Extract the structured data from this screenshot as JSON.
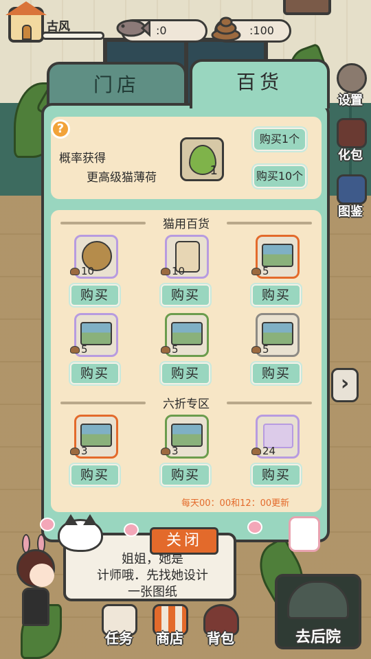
{
  "hud": {
    "player_name": "古风",
    "fish_count": ":0",
    "poop_count": ":100"
  },
  "side": {
    "settings": "设置",
    "backpack": "化包",
    "collection": "图鉴"
  },
  "tabs": {
    "store": "门店",
    "goods": "百货"
  },
  "promo": {
    "line1": "概率获得",
    "line2": "更高级猫薄荷",
    "catnip_count": "1",
    "buy1": "购买1个",
    "buy10": "购买10个"
  },
  "sections": {
    "cat_goods": "猫用百货",
    "discount": "六折专区"
  },
  "items": [
    {
      "price": "10",
      "buy": "购买"
    },
    {
      "price": "10",
      "buy": "购买"
    },
    {
      "price": "5",
      "buy": "购买"
    },
    {
      "price": "5",
      "buy": "购买"
    },
    {
      "price": "5",
      "buy": "购买"
    },
    {
      "price": "5",
      "buy": "购买"
    }
  ],
  "discount_items": [
    {
      "price": "3",
      "buy": "购买"
    },
    {
      "price": "3",
      "buy": "购买"
    },
    {
      "price": "24",
      "buy": "购买"
    }
  ],
  "refresh_note": "每天00：00和12：00更新",
  "close": "关闭",
  "dialog": {
    "line1": "姐姐，她是",
    "line2": "计师哦．先找她设计",
    "line3": "一张图纸"
  },
  "bottom": {
    "tasks": "任务",
    "shop": "商店",
    "bag": "背包",
    "yard": "去后院"
  }
}
